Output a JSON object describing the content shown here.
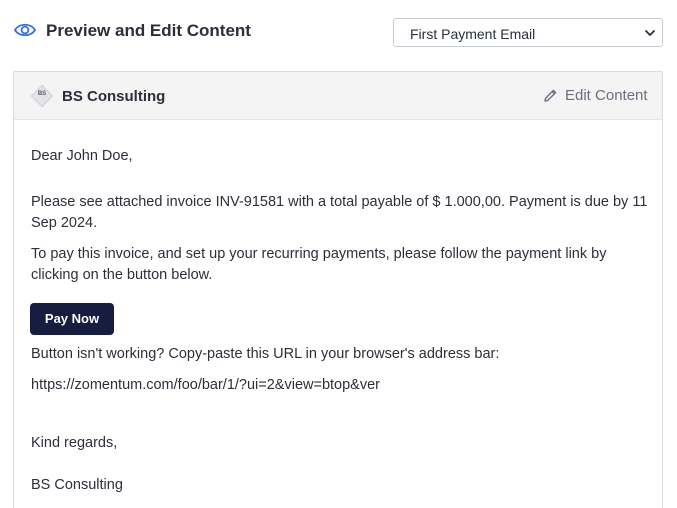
{
  "header": {
    "title": "Preview and Edit Content",
    "icon": "eye-icon",
    "accent_color": "#3b6fd8"
  },
  "template_select": {
    "selected": "First Payment Email",
    "icon": "chevron-down-icon"
  },
  "card": {
    "logo_text": "BS",
    "company_name": "BS Consulting",
    "edit_label": "Edit Content",
    "edit_icon": "pencil-icon"
  },
  "email": {
    "greeting": "Dear John Doe,",
    "paragraph1": "Please see attached invoice INV-91581 with a total payable of $ 1.000,00. Payment is due by 11 Sep 2024.",
    "paragraph2": "To pay this invoice, and set up your recurring payments, please follow the payment link by clicking on the button below.",
    "pay_button": "Pay Now",
    "pay_button_color": "#161d3f",
    "fallback_hint": "Button isn't working? Copy-paste this URL in your browser's address bar:",
    "url": "https://zomentum.com/foo/bar/1/?ui=2&view=btop&ver",
    "closing": "Kind regards,",
    "signature": "BS Consulting"
  }
}
